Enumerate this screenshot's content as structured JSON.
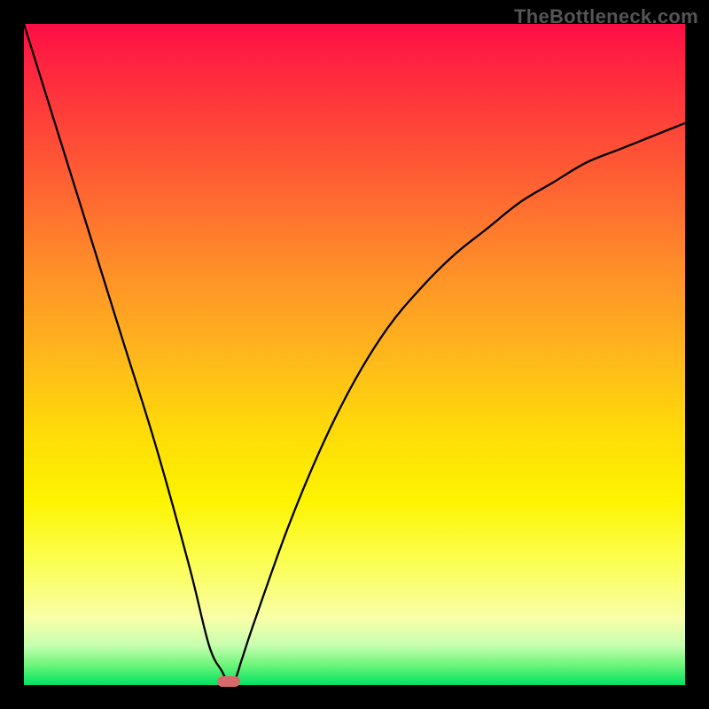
{
  "watermark": "TheBottleneck.com",
  "chart_data": {
    "type": "line",
    "title": "",
    "xlabel": "",
    "ylabel": "",
    "xlim": [
      0,
      100
    ],
    "ylim": [
      0,
      100
    ],
    "grid": false,
    "legend": false,
    "series": [
      {
        "name": "bottleneck-curve",
        "x": [
          0,
          5,
          10,
          15,
          20,
          25,
          28,
          30,
          31,
          32,
          33,
          35,
          40,
          45,
          50,
          55,
          60,
          65,
          70,
          75,
          80,
          85,
          90,
          95,
          100
        ],
        "y": [
          100,
          84,
          68,
          52,
          36,
          18,
          6,
          2,
          0,
          1,
          4,
          10,
          24,
          36,
          46,
          54,
          60,
          65,
          69,
          73,
          76,
          79,
          81,
          83,
          85
        ]
      }
    ],
    "annotations": [
      {
        "name": "minimum-marker",
        "x": 31,
        "y": 0
      }
    ],
    "background_gradient": {
      "top": "#ff0e46",
      "mid": "#ffdc08",
      "bottom": "#00e262",
      "meaning": "red high / green low"
    }
  }
}
